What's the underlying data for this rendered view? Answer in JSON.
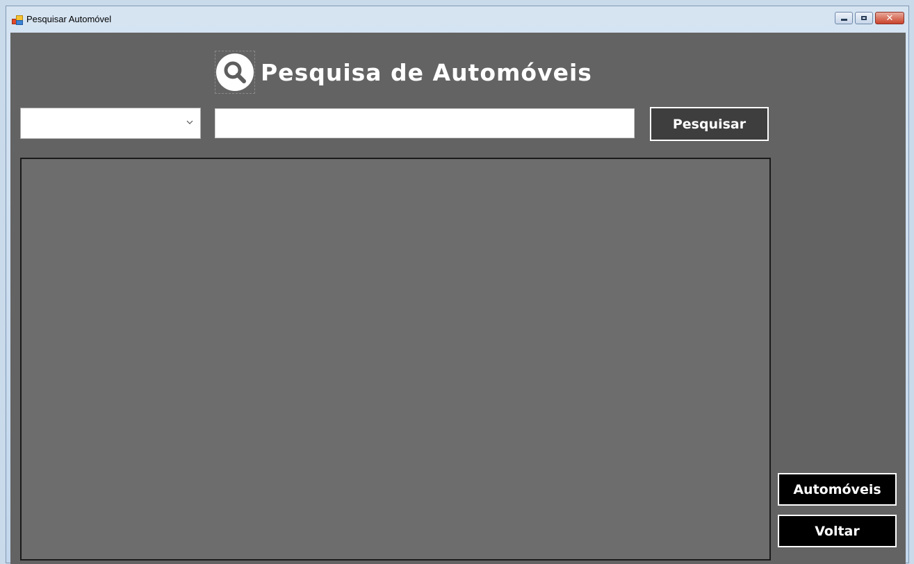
{
  "window": {
    "title": "Pesquisar Automóvel",
    "controls": {
      "minimize": "",
      "maximize": "",
      "close": "✕"
    }
  },
  "header": {
    "title": "Pesquisa de Automóveis",
    "icon": "search-icon"
  },
  "filter": {
    "selected": "",
    "icon": "chevron-down-icon"
  },
  "search": {
    "value": "",
    "placeholder": ""
  },
  "buttons": {
    "search": "Pesquisar",
    "automoveis": "Automóveis",
    "voltar": "Voltar"
  },
  "colors": {
    "background": "#636363",
    "grid": "#6d6d6d",
    "button_dark": "#3e3e3e",
    "button_black": "#000000",
    "text": "#ffffff"
  }
}
